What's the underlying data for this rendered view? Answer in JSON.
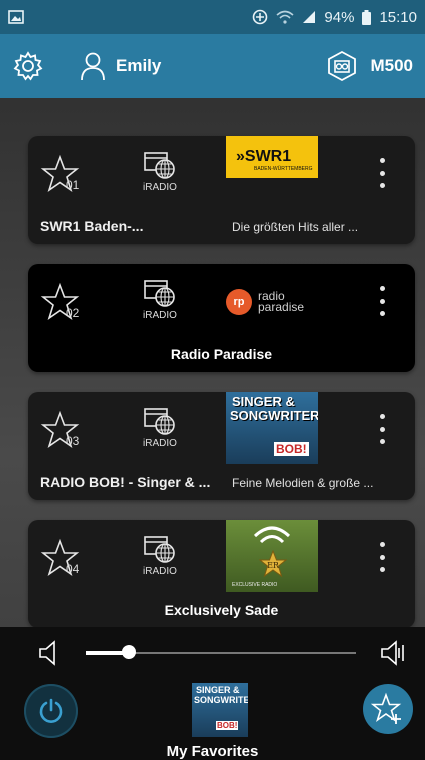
{
  "status": {
    "battery": "94%",
    "time": "15:10",
    "icons": [
      "screenshot-icon",
      "sync-icon",
      "wifi-icon",
      "signal-icon",
      "battery-icon"
    ]
  },
  "appbar": {
    "user_name": "Emily",
    "device_name": "M500",
    "icons": [
      "gear-icon",
      "user-icon",
      "speaker-device-icon"
    ]
  },
  "favorites": [
    {
      "number": "01",
      "source": "iRADIO",
      "name": "SWR1 Baden-...",
      "description": "Die größten Hits aller ...",
      "logo_title": "»SWR1",
      "logo_sub": "BADEN-WÜRTTEMBERG"
    },
    {
      "number": "02",
      "source": "iRADIO",
      "name": "Radio Paradise",
      "logo_mark": "rp",
      "logo_line1": "radio",
      "logo_line2": "paradise"
    },
    {
      "number": "03",
      "source": "iRADIO",
      "name": "RADIO BOB! - Singer & ...",
      "description": "Feine Melodien & große ...",
      "logo_line1": "SINGER &",
      "logo_line2": "SONGWRITER",
      "logo_brand": "BOB!"
    },
    {
      "number": "04",
      "source": "iRADIO",
      "name": "Exclusively Sade",
      "logo_mark": "ER",
      "logo_caption": "EXCLUSIVE RADIO"
    }
  ],
  "player": {
    "volume_fraction": 0.16,
    "now_playing_label": "My Favorites",
    "art_line1": "SINGER &",
    "art_line2": "SONGWRITER",
    "art_brand": "BOB!",
    "icons": [
      "volume-mute-icon",
      "volume-up-icon",
      "power-icon",
      "add-favorite-icon"
    ],
    "accent": "#2a7ba1"
  }
}
